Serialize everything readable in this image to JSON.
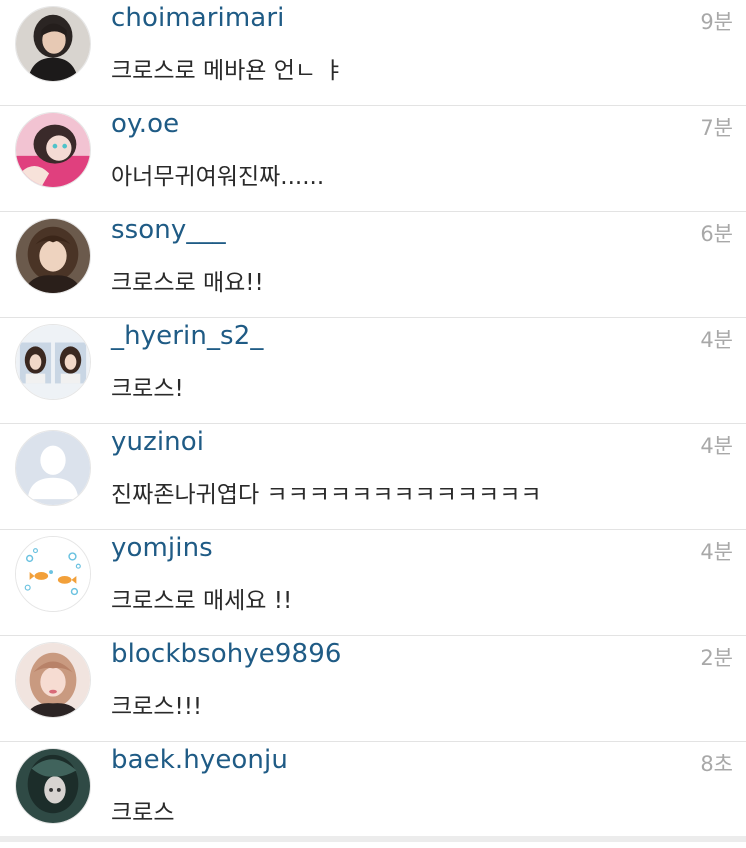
{
  "comments": [
    {
      "username": "choimarimari",
      "text": "크로스로 메바욘 언ㄴ ㅑ",
      "time": "9분",
      "avatar": "photo-dark-hair"
    },
    {
      "username": "oy.oe",
      "text": "아너무귀여워진짜......",
      "time": "7분",
      "avatar": "photo-pink"
    },
    {
      "username": "ssony___",
      "text": "크로스로 매요!!",
      "time": "6분",
      "avatar": "photo-brown-hair"
    },
    {
      "username": "_hyerin_s2_",
      "text": "크로스!",
      "time": "4분",
      "avatar": "photo-two-girls"
    },
    {
      "username": "yuzinoi",
      "text": "진짜존나귀엽다 ㅋㅋㅋㅋㅋㅋㅋㅋㅋㅋㅋㅋㅋ",
      "time": "4분",
      "avatar": "default-user-icon"
    },
    {
      "username": "yomjins",
      "text": "크로스로 매세요 !!",
      "time": "4분",
      "avatar": "bubbles-fish"
    },
    {
      "username": "blockbsohye9896",
      "text": "크로스!!!",
      "time": "2분",
      "avatar": "photo-light-hair"
    },
    {
      "username": "baek.hyeonju",
      "text": "크로스",
      "time": "8초",
      "avatar": "photo-dark-teal"
    }
  ]
}
